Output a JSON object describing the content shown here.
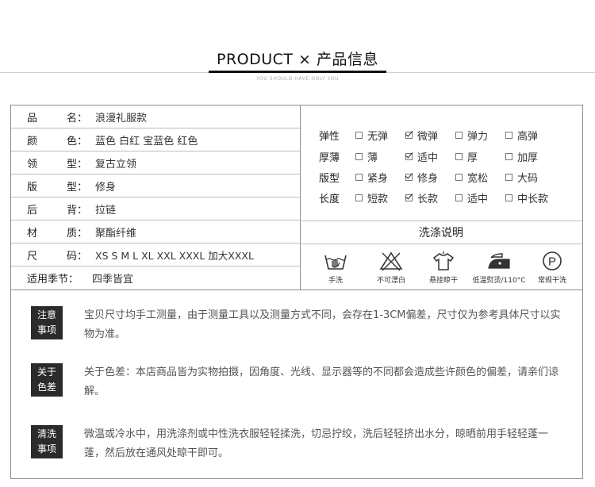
{
  "header": {
    "title": "PRODUCT × 产品信息",
    "subtitle": "YOU SHOULD HAVE ONLY YOU"
  },
  "specs": [
    {
      "label": "品 名：",
      "value": "浪漫礼服款"
    },
    {
      "label": "颜 色：",
      "value": "蓝色 白红 宝蓝色 红色"
    },
    {
      "label": "领 型：",
      "value": "复古立领"
    },
    {
      "label": "版 型：",
      "value": "修身"
    },
    {
      "label": "后 背：",
      "value": "拉链"
    },
    {
      "label": "材 质：",
      "value": "聚酯纤维"
    },
    {
      "label": "尺 码：",
      "value": "XS S M L XL XXL XXXL 加大XXXL"
    },
    {
      "label": "适用季节：",
      "value": "四季皆宜"
    }
  ],
  "attributes": [
    {
      "name": "弹性",
      "options": [
        {
          "label": "无弹",
          "checked": false
        },
        {
          "label": "微弹",
          "checked": true
        },
        {
          "label": "弹力",
          "checked": false
        },
        {
          "label": "高弹",
          "checked": false
        }
      ]
    },
    {
      "name": "厚薄",
      "options": [
        {
          "label": "薄",
          "checked": false
        },
        {
          "label": "适中",
          "checked": true
        },
        {
          "label": "厚",
          "checked": false
        },
        {
          "label": "加厚",
          "checked": false
        }
      ]
    },
    {
      "name": "版型",
      "options": [
        {
          "label": "紧身",
          "checked": false
        },
        {
          "label": "修身",
          "checked": true
        },
        {
          "label": "宽松",
          "checked": false
        },
        {
          "label": "大码",
          "checked": false
        }
      ]
    },
    {
      "name": "长度",
      "options": [
        {
          "label": "短款",
          "checked": false
        },
        {
          "label": "长款",
          "checked": true
        },
        {
          "label": "适中",
          "checked": false
        },
        {
          "label": "中长款",
          "checked": false
        }
      ]
    }
  ],
  "wash": {
    "title": "洗涤说明",
    "items": [
      {
        "icon": "hand-wash-icon",
        "label": "手洗"
      },
      {
        "icon": "no-bleach-icon",
        "label": "不可漂白"
      },
      {
        "icon": "hang-dry-icon",
        "label": "悬挂晾干"
      },
      {
        "icon": "iron-low-icon",
        "label": "低温熨烫/110°C"
      },
      {
        "icon": "dry-clean-icon",
        "label": "常规干洗"
      }
    ],
    "dry_clean_letter": "P"
  },
  "notes": [
    {
      "tag1": "注意",
      "tag2": "事项",
      "text": "宝贝尺寸均手工测量，由于测量工具以及测量方式不同，会存在1-3CM偏差，尺寸仅为参考具体尺寸以实物为准。"
    },
    {
      "tag1": "关于",
      "tag2": "色差",
      "text": "关于色差：本店商品皆为实物拍摄，因角度、光线、显示器等的不同都会造成些许颜色的偏差，请亲们谅解。"
    },
    {
      "tag1": "清洗",
      "tag2": "事项",
      "text": "微温或冷水中，用洗涤剂或中性洗衣服轻轻揉洗，切忌拧绞，洗后轻轻挤出水分，晾晒前用手轻轻蓬一蓬，然后放在通风处晾干即可。"
    }
  ]
}
